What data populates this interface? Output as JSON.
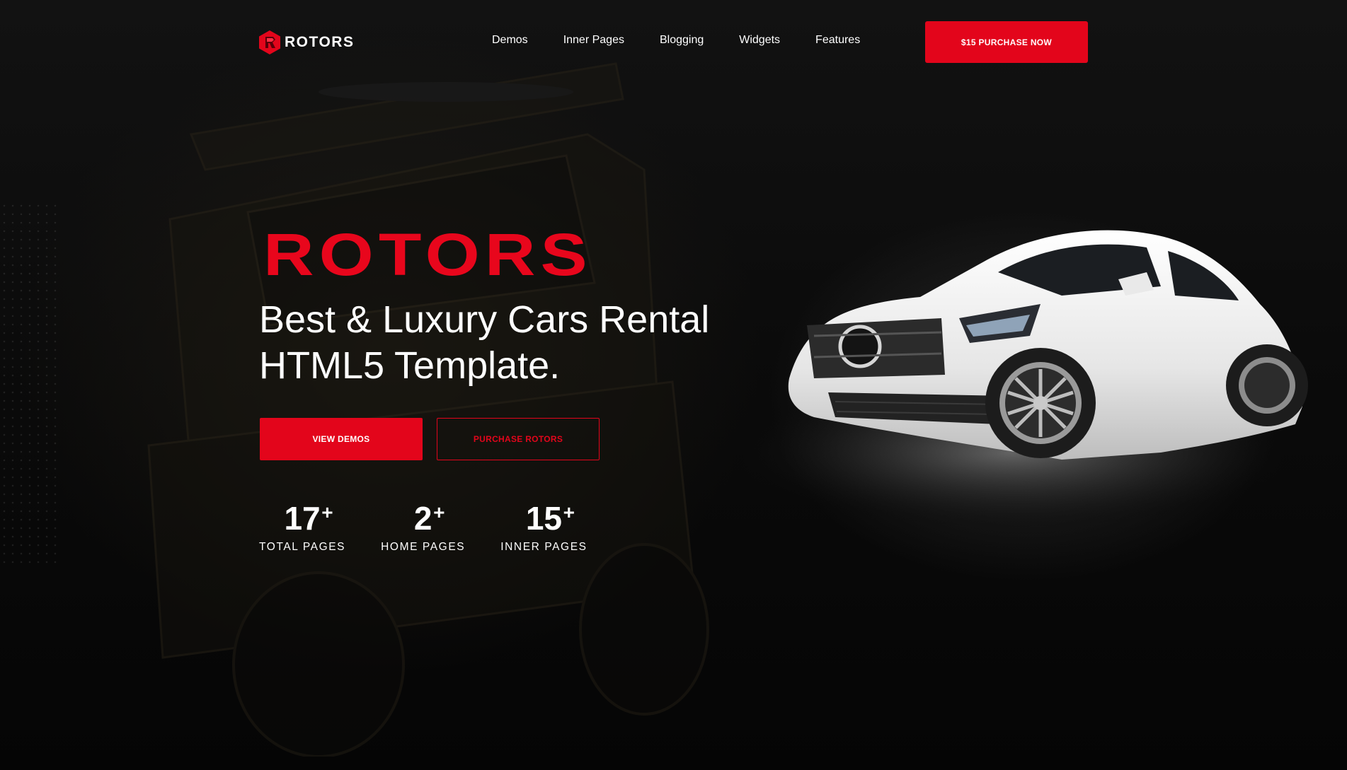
{
  "brand": {
    "logo_text": "ROTORS",
    "accent_color": "#e3051b"
  },
  "nav": {
    "items": [
      "Demos",
      "Inner Pages",
      "Blogging",
      "Widgets",
      "Features"
    ],
    "purchase_label": "$15 PURCHASE NOW"
  },
  "hero": {
    "brand_title": "ROTORS",
    "headline_line1": "Best & Luxury Cars Rental",
    "headline_line2": "HTML5 Template.",
    "primary_button": "VIEW DEMOS",
    "secondary_button": "PURCHASE ROTORS"
  },
  "stats": [
    {
      "number": "17",
      "suffix": "+",
      "label": "TOTAL PAGES"
    },
    {
      "number": "2",
      "suffix": "+",
      "label": "HOME PAGES"
    },
    {
      "number": "15",
      "suffix": "+",
      "label": "INNER PAGES"
    }
  ],
  "icons": {
    "logo": "rotors-logo-icon"
  }
}
